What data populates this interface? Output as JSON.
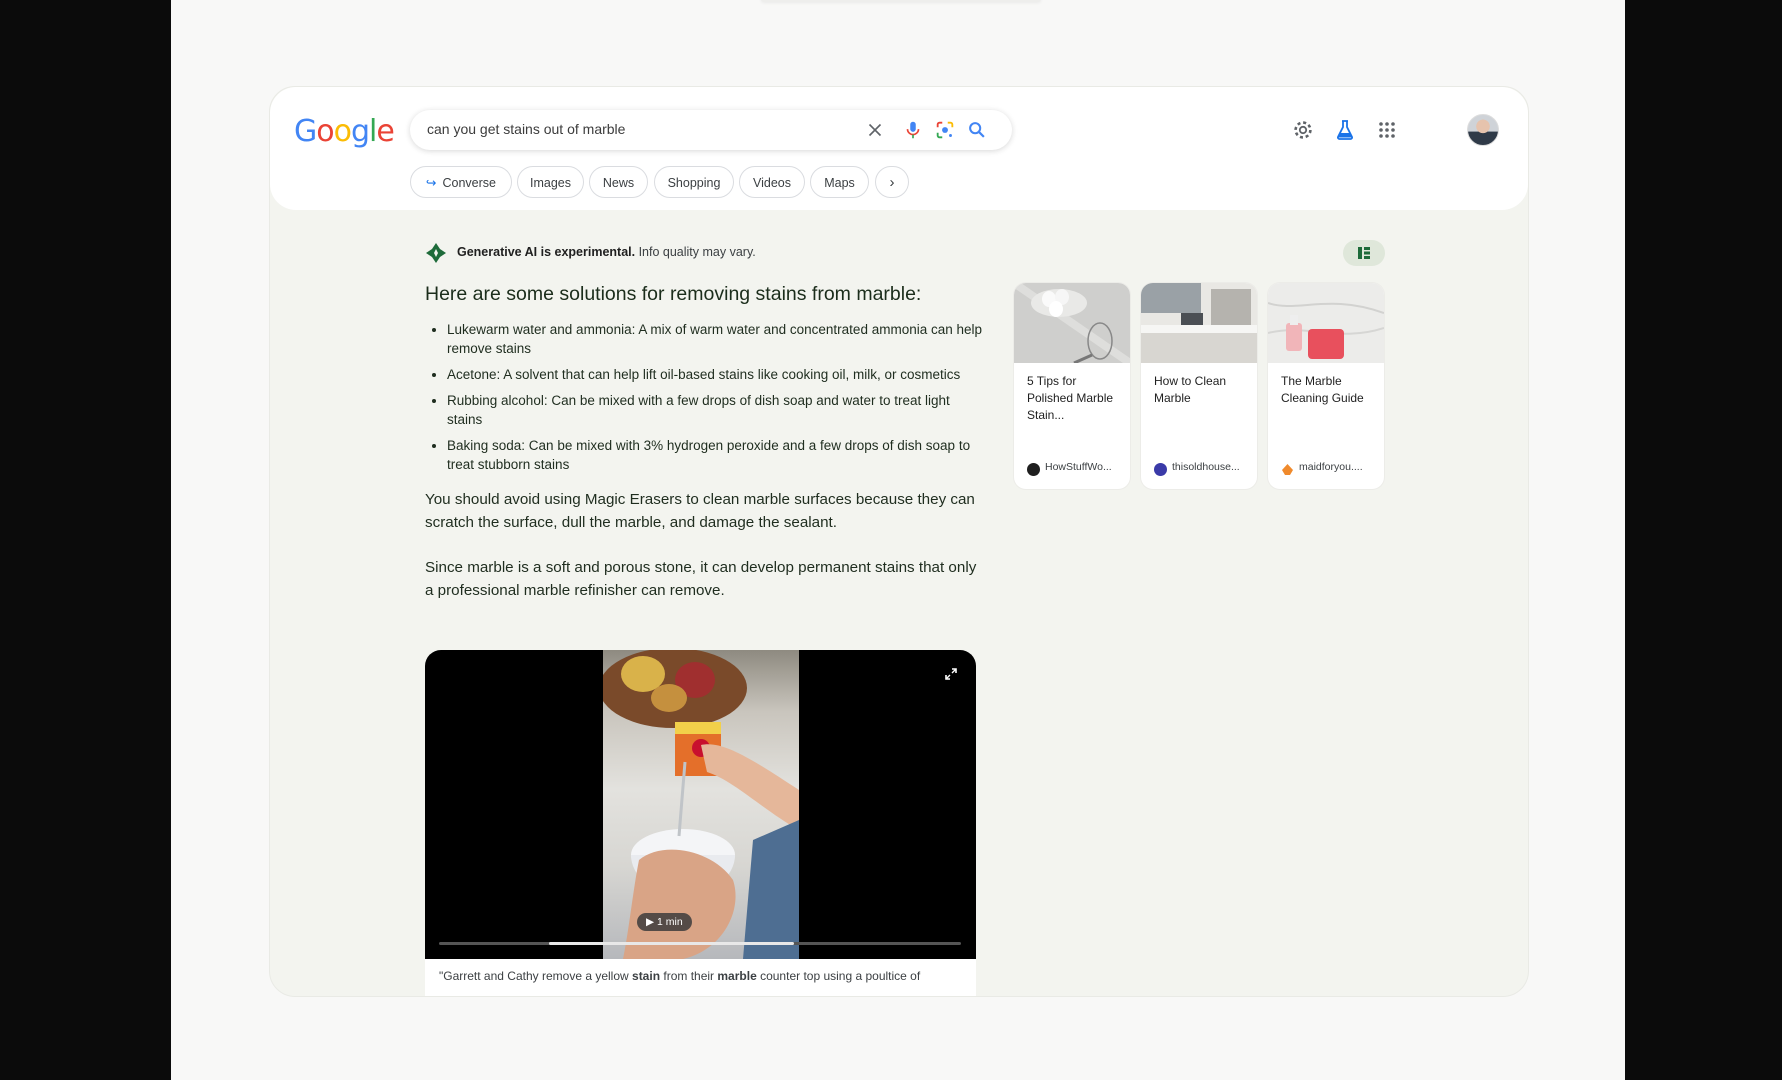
{
  "search": {
    "query": "can you get stains out of marble"
  },
  "logo": {
    "letters": [
      "G",
      "o",
      "o",
      "g",
      "l",
      "e"
    ]
  },
  "chips": [
    {
      "label": "Converse",
      "icon": "converse-arrow-icon"
    },
    {
      "label": "Images"
    },
    {
      "label": "News"
    },
    {
      "label": "Shopping"
    },
    {
      "label": "Videos"
    },
    {
      "label": "Maps"
    }
  ],
  "ai_banner": {
    "bold": "Generative AI is experimental.",
    "rest": " Info quality may vary."
  },
  "answer": {
    "heading": "Here are some solutions for removing stains from marble:",
    "bullets": [
      "Lukewarm water and ammonia: A mix of warm water and concentrated ammonia can help remove stains",
      "Acetone: A solvent that can help lift oil-based stains like cooking oil, milk, or cosmetics",
      "Rubbing alcohol: Can be mixed with a few drops of dish soap and water to treat light stains",
      "Baking soda: Can be mixed with 3% hydrogen peroxide and a few drops of dish soap to treat stubborn stains"
    ],
    "para1": "You should avoid using Magic Erasers to clean marble surfaces because they can scratch the surface, dull the marble, and damage the sealant.",
    "para2": "Since marble is a soft and porous stone, it can develop permanent stains that only a professional marble refinisher can remove."
  },
  "video": {
    "duration": "1 min",
    "progress_start": 0.21,
    "progress_end": 0.68,
    "caption_a": "\"Garrett and Cathy remove a yellow ",
    "caption_b": "stain",
    "caption_c": " from their ",
    "caption_d": "marble",
    "caption_e": " counter top using a poultice of"
  },
  "cards": [
    {
      "title": "5 Tips for Polished Marble Stain...",
      "source": "HowStuffWo...",
      "dot_color": "#1f1f1f"
    },
    {
      "title": "How to Clean Marble",
      "source": "thisoldhouse...",
      "dot_color": "#3a3aa8"
    },
    {
      "title": "The Marble Cleaning Guide",
      "source": "maidforyou....",
      "dot_color": "#f08a2c"
    }
  ],
  "colors": {
    "google_blue": "#4285F4",
    "google_red": "#EA4335",
    "google_yellow": "#FBBC05",
    "google_green": "#34A853",
    "ai_green": "#1e6b3a"
  }
}
